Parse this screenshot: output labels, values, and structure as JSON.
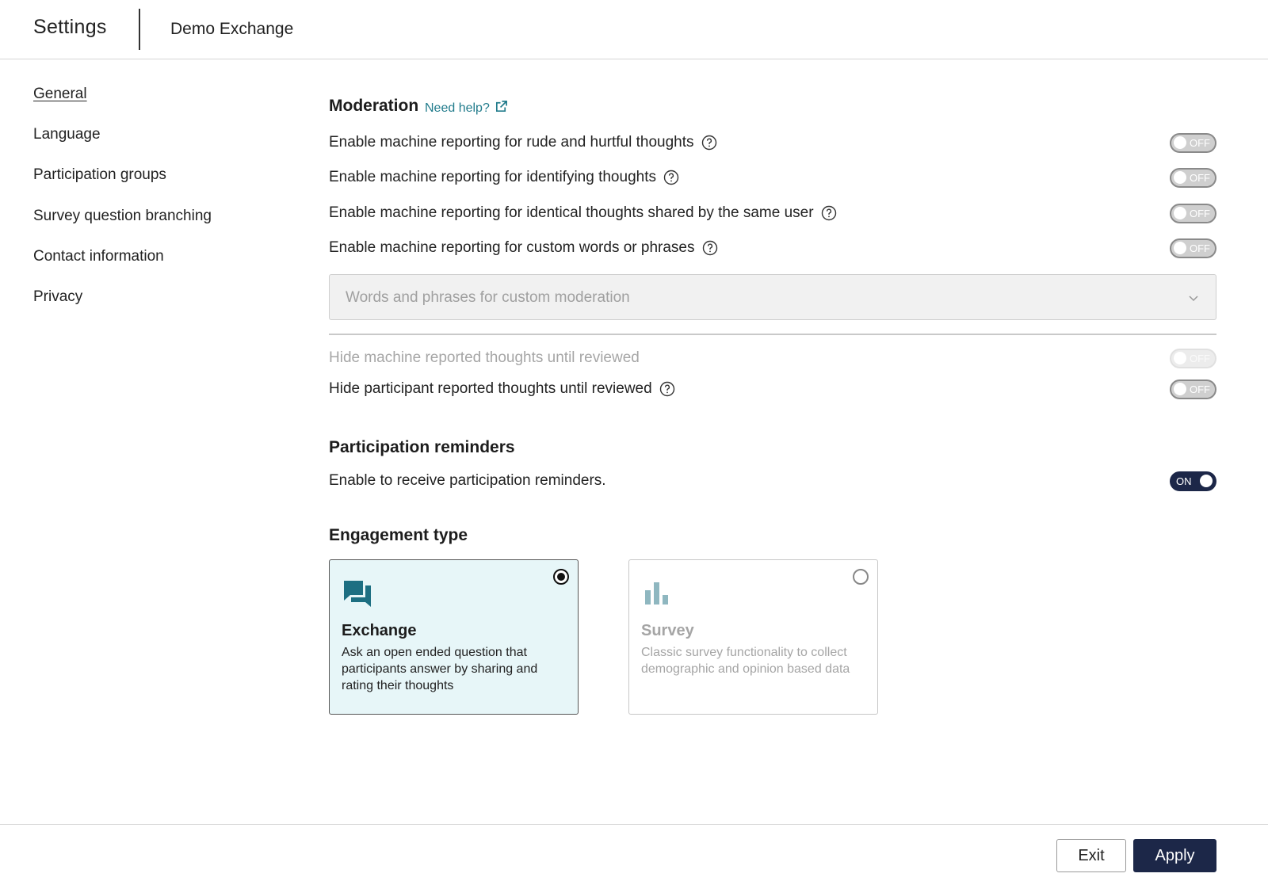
{
  "header": {
    "title": "Settings",
    "subtitle": "Demo Exchange"
  },
  "sidebar": {
    "items": [
      {
        "label": "General",
        "active": true
      },
      {
        "label": "Language"
      },
      {
        "label": "Participation groups"
      },
      {
        "label": "Survey question branching"
      },
      {
        "label": "Contact information"
      },
      {
        "label": "Privacy"
      }
    ]
  },
  "moderation": {
    "title": "Moderation",
    "help_link": "Need help?",
    "settings": [
      {
        "label": "Enable machine reporting for rude and hurtful thoughts",
        "toggle": "OFF"
      },
      {
        "label": "Enable machine reporting for identifying thoughts",
        "toggle": "OFF"
      },
      {
        "label": "Enable machine reporting for identical thoughts shared by the same user",
        "toggle": "OFF"
      },
      {
        "label": "Enable machine reporting for custom words or phrases",
        "toggle": "OFF"
      }
    ],
    "custom_words_placeholder": "Words and phrases for custom moderation",
    "hide_machine": {
      "label": "Hide machine reported thoughts until reviewed",
      "toggle": "OFF",
      "disabled": true
    },
    "hide_participant": {
      "label": "Hide participant reported thoughts until reviewed",
      "toggle": "OFF"
    }
  },
  "reminders": {
    "title": "Participation reminders",
    "label": "Enable to receive participation reminders.",
    "toggle": "ON"
  },
  "engagement": {
    "title": "Engagement type",
    "options": [
      {
        "title": "Exchange",
        "description": "Ask an open ended question that participants answer by sharing and rating their thoughts",
        "selected": true,
        "icon": "chat-bubbles-icon"
      },
      {
        "title": "Survey",
        "description": "Classic survey functionality to collect demographic and opinion based data",
        "selected": false,
        "icon": "bar-chart-icon"
      }
    ]
  },
  "footer": {
    "exit_label": "Exit",
    "apply_label": "Apply"
  },
  "colors": {
    "accent_navy": "#1c2748",
    "link_teal": "#227c8c",
    "selected_card_bg": "#e7f6f8",
    "icon_teal": "#1d6f82"
  }
}
